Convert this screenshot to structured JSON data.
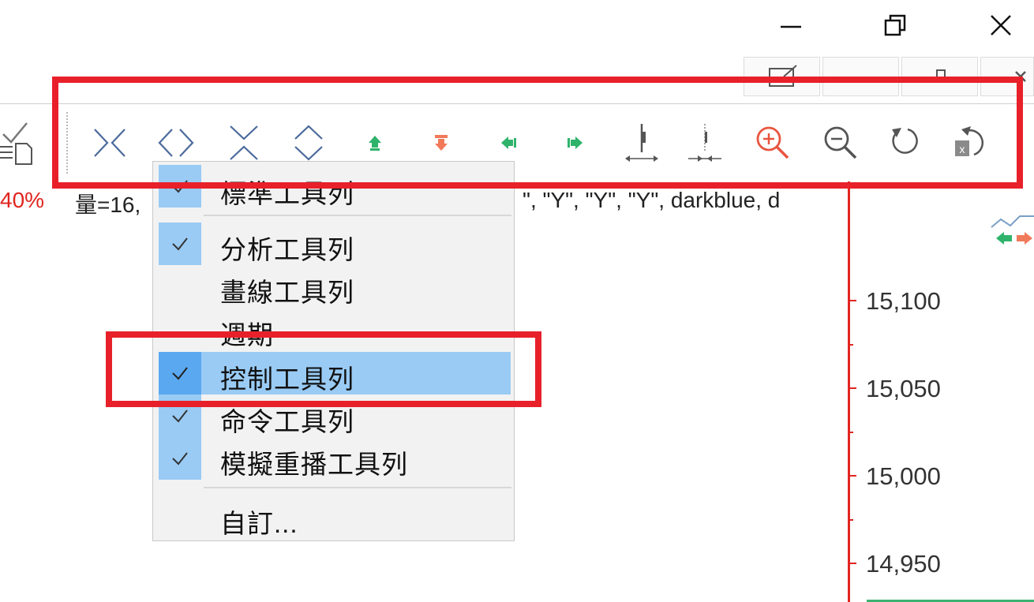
{
  "window_controls": {
    "minimize_icon": "minimize-icon",
    "maximize_icon": "restore-icon",
    "close_icon": "close-icon"
  },
  "toolbar": {
    "buttons": [
      {
        "name": "compress-horizontal-icon",
        "color": "#4b6a9b"
      },
      {
        "name": "expand-horizontal-icon",
        "color": "#4b6a9b"
      },
      {
        "name": "compress-vertical-icon",
        "color": "#4b6a9b"
      },
      {
        "name": "expand-vertical-icon",
        "color": "#4b6a9b"
      },
      {
        "name": "move-up-icon",
        "color": "#2fb36b"
      },
      {
        "name": "move-down-icon",
        "color": "#f07a5a"
      },
      {
        "name": "move-left-icon",
        "color": "#2fb36b"
      },
      {
        "name": "move-right-icon",
        "color": "#2fb36b"
      },
      {
        "name": "widen-bars-icon",
        "color": "#555555"
      },
      {
        "name": "narrow-bars-icon",
        "color": "#555555"
      },
      {
        "name": "zoom-in-icon",
        "color": "#e8553f"
      },
      {
        "name": "zoom-out-icon",
        "color": "#555555"
      },
      {
        "name": "reset-icon",
        "color": "#555555"
      },
      {
        "name": "clear-reset-icon",
        "color": "#555555"
      }
    ]
  },
  "status": {
    "percent": "40%",
    "text_left": "量=16,",
    "text_right": "\", \"Y\", \"Y\", \"Y\", darkblue, d"
  },
  "axis": {
    "labels": [
      "15,100",
      "15,050",
      "15,000",
      "14,950"
    ],
    "color": "#e0251f"
  },
  "menu": {
    "items": [
      {
        "label": "標準工具列",
        "checked": true
      },
      {
        "label": "分析工具列",
        "checked": true
      },
      {
        "label": "畫線工具列",
        "checked": false
      },
      {
        "label": "週期",
        "checked": false
      },
      {
        "label": "控制工具列",
        "checked": true,
        "highlighted": true
      },
      {
        "label": "命令工具列",
        "checked": true
      },
      {
        "label": "模擬重播工具列",
        "checked": true
      },
      {
        "label": "自訂...",
        "checked": false
      }
    ]
  },
  "colors": {
    "annotation_red": "#e8202a",
    "menu_highlight": "#99cbf5",
    "check_highlight": "#5aa8ef"
  }
}
